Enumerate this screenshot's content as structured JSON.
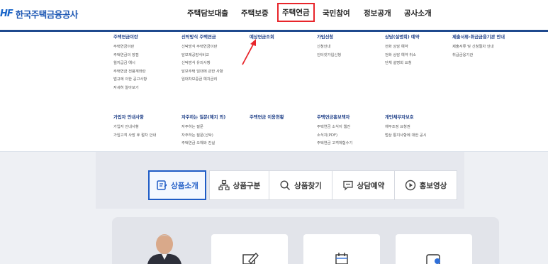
{
  "logo": {
    "mark": "HF",
    "text": "한국주택금융공사"
  },
  "gnb": [
    {
      "label": "주택담보대출",
      "active": false
    },
    {
      "label": "주택보증",
      "active": false
    },
    {
      "label": "주택연금",
      "active": true
    },
    {
      "label": "국민참여",
      "active": false
    },
    {
      "label": "정보공개",
      "active": false
    },
    {
      "label": "공사소개",
      "active": false
    }
  ],
  "mega": {
    "c1": {
      "title": "주택연금이란",
      "links": [
        "주택연금이란",
        "주택연금의 장점",
        "월지급금 예시",
        "주택연금 전용계좌란",
        "법규에 의한 공고사항",
        "자세히 알아보기"
      ]
    },
    "c2": {
      "title": "신탁방식 주택연금",
      "links": [
        "신탁방식 주택연금이란",
        "담보제공방식비교",
        "신탁방식 유의사항",
        "담보주택 임대에 관한 사항",
        "임대차보증금 예치금리"
      ]
    },
    "c3": {
      "title": "예상연금조회",
      "links": []
    },
    "c4": {
      "title": "가입신청",
      "links": [
        "신청안내",
        "인터넷가입신청"
      ]
    },
    "c5": {
      "title": "상담(설명회) 예약",
      "links": [
        "전화 상담 예약",
        "전화 상담 예약 취소",
        "단체 설명회 요청"
      ]
    },
    "c6": {
      "title": "제출서류·취급금융기관 안내",
      "links": [
        "제출서류 및 신청절차 안내",
        "취급금융기관"
      ]
    },
    "c7": {
      "title": "가입자 안내사항",
      "links": [
        "가입자 안내사항",
        "가입고객 사망 후 절차 안내"
      ]
    },
    "c8": {
      "title": "자주하는 질문(해지 외)",
      "links": [
        "자주하는 질문",
        "자주하는 질문(신탁)",
        "주택연금 오해와 진실"
      ]
    },
    "c9": {
      "title": "주택연금 이용현황",
      "links": []
    },
    "c10": {
      "title": "주택연금홍보책자",
      "links": [
        "주택연금 소식지 웹진",
        "소식지(PDF)",
        "주택연금 고객체험수기"
      ]
    },
    "c11": {
      "title": "개인채무자보호",
      "links": [
        "채무조정 요청권",
        "법상 통지사항에 대한 공시"
      ]
    }
  },
  "tabs": [
    {
      "label": "상품소개",
      "active": true,
      "icon": "product-intro-icon"
    },
    {
      "label": "상품구분",
      "active": false,
      "icon": "hierarchy-icon"
    },
    {
      "label": "상품찾기",
      "active": false,
      "icon": "search-icon"
    },
    {
      "label": "상담예약",
      "active": false,
      "icon": "chat-icon"
    },
    {
      "label": "홍보영상",
      "active": false,
      "icon": "play-icon"
    }
  ],
  "colors": {
    "brand_blue": "#1f4a8e",
    "menu_title": "#1d3e87",
    "active_tab": "#1f5cc6",
    "highlight_red": "#e8252b"
  }
}
